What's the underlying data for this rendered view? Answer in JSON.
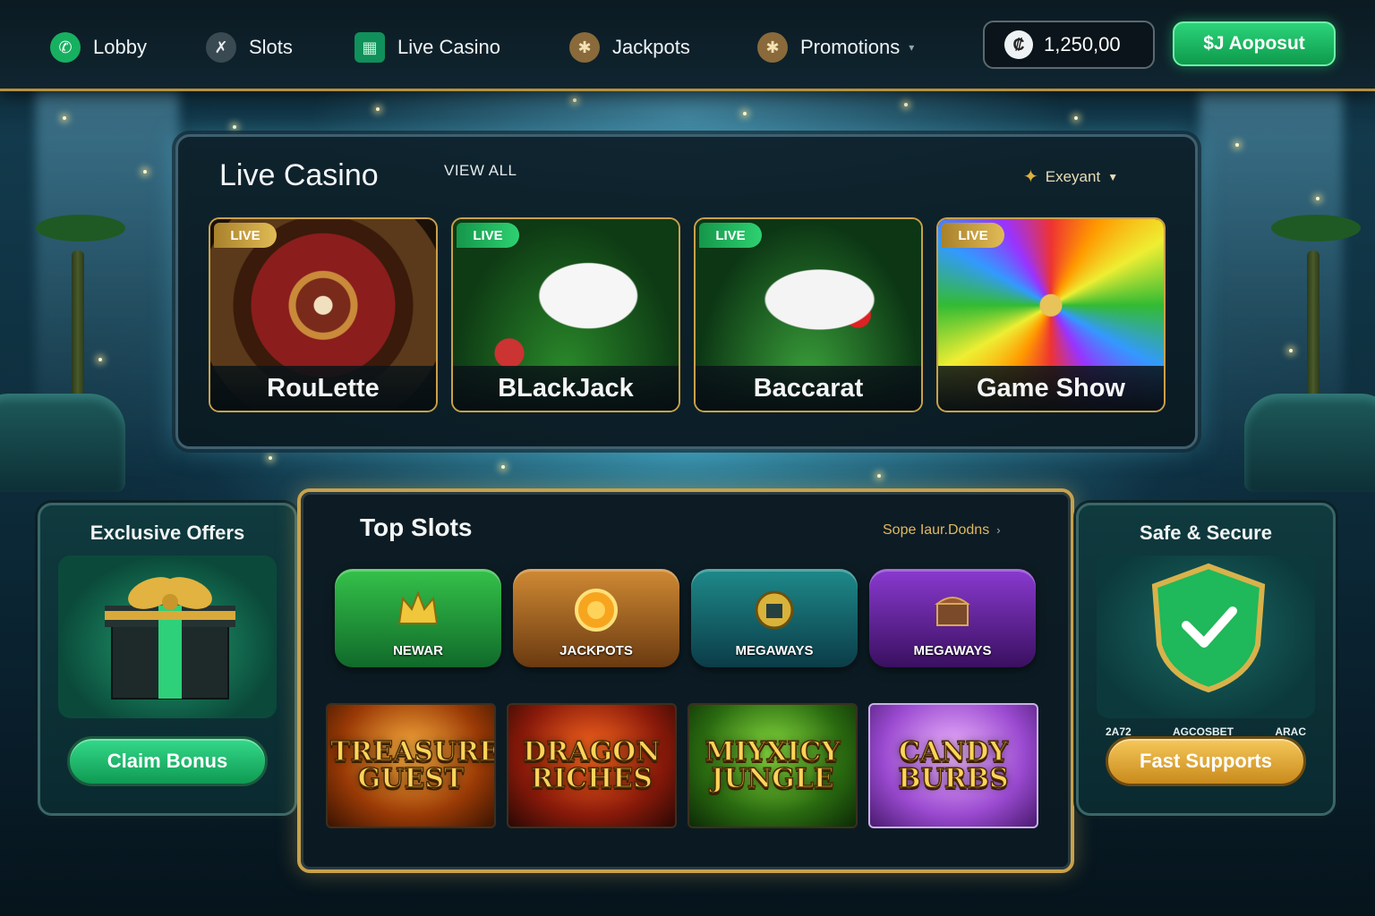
{
  "nav": {
    "items": [
      {
        "label": "Lobby",
        "icon": "phone-icon"
      },
      {
        "label": "Slots",
        "icon": "slot-icon"
      },
      {
        "label": "Live Casino",
        "icon": "live-casino-icon"
      },
      {
        "label": "Jackpots",
        "icon": "jackpot-icon"
      },
      {
        "label": "Promotions",
        "icon": "promotions-icon"
      }
    ],
    "balance": " 1,250,00",
    "balance_display": "1,250,00",
    "deposit_label": "$J Aoposut"
  },
  "live_casino": {
    "title": "Live Casino",
    "view_all": "VIEW ALL",
    "filter": "Exeyant",
    "badge": "LIVE",
    "games": [
      {
        "name": "RouLette",
        "badge_color": "gold"
      },
      {
        "name": "BLackJack",
        "badge_color": "green"
      },
      {
        "name": "Baccarat",
        "badge_color": "green"
      },
      {
        "name": "Game Show",
        "badge_color": "gold"
      }
    ]
  },
  "offers": {
    "title": "Exclusive Offers",
    "button": "Claim Bonus"
  },
  "top_slots": {
    "title": "Top Slots",
    "link": "Sope Iaur.Dodns",
    "categories": [
      {
        "label": "NEWAR"
      },
      {
        "label": "JACKPOTS"
      },
      {
        "label": "MEGAWAYS"
      },
      {
        "label": "MEGAWAYS"
      }
    ],
    "games": [
      {
        "name": "TREASURE GUEST"
      },
      {
        "name": "DRAGON RICHES"
      },
      {
        "name": "MIYXICY JUNGLE"
      },
      {
        "name": "CANDY BURBS"
      }
    ]
  },
  "security": {
    "title": "Safe & Secure",
    "brands": [
      "2A72",
      "AGCOSBET",
      "ARAC"
    ],
    "button": "Fast Supports"
  },
  "colors": {
    "accent_gold": "#c9a14a",
    "accent_green": "#1fbf68",
    "panel_dark": "#0d1c24"
  }
}
